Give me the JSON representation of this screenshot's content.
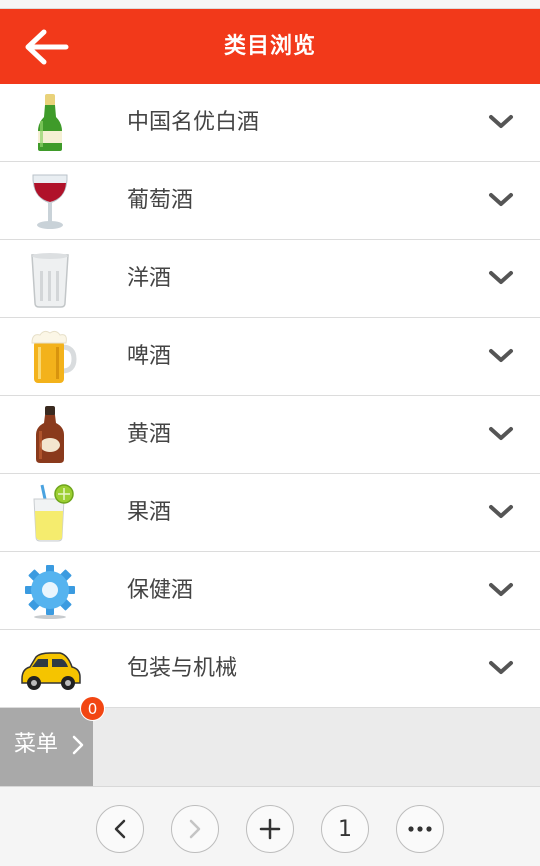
{
  "header": {
    "title": "类目浏览",
    "back_icon": "back-arrow-icon"
  },
  "categories": [
    {
      "label": "中国名优白酒",
      "icon": "champagne-bottle-icon"
    },
    {
      "label": "葡萄酒",
      "icon": "wine-glass-icon"
    },
    {
      "label": "洋酒",
      "icon": "whisky-glass-icon"
    },
    {
      "label": "啤酒",
      "icon": "beer-mug-icon"
    },
    {
      "label": "黄酒",
      "icon": "liquor-bottle-icon"
    },
    {
      "label": "果酒",
      "icon": "cocktail-glass-icon"
    },
    {
      "label": "保健酒",
      "icon": "gear-icon"
    },
    {
      "label": "包装与机械",
      "icon": "car-icon"
    }
  ],
  "menu": {
    "label": "菜单",
    "badge": "0"
  },
  "toolbar": {
    "page_number": "1"
  },
  "colors": {
    "header_bg": "#f2391a",
    "badge_bg": "#f24612",
    "menu_bg": "#a9a9a9"
  }
}
